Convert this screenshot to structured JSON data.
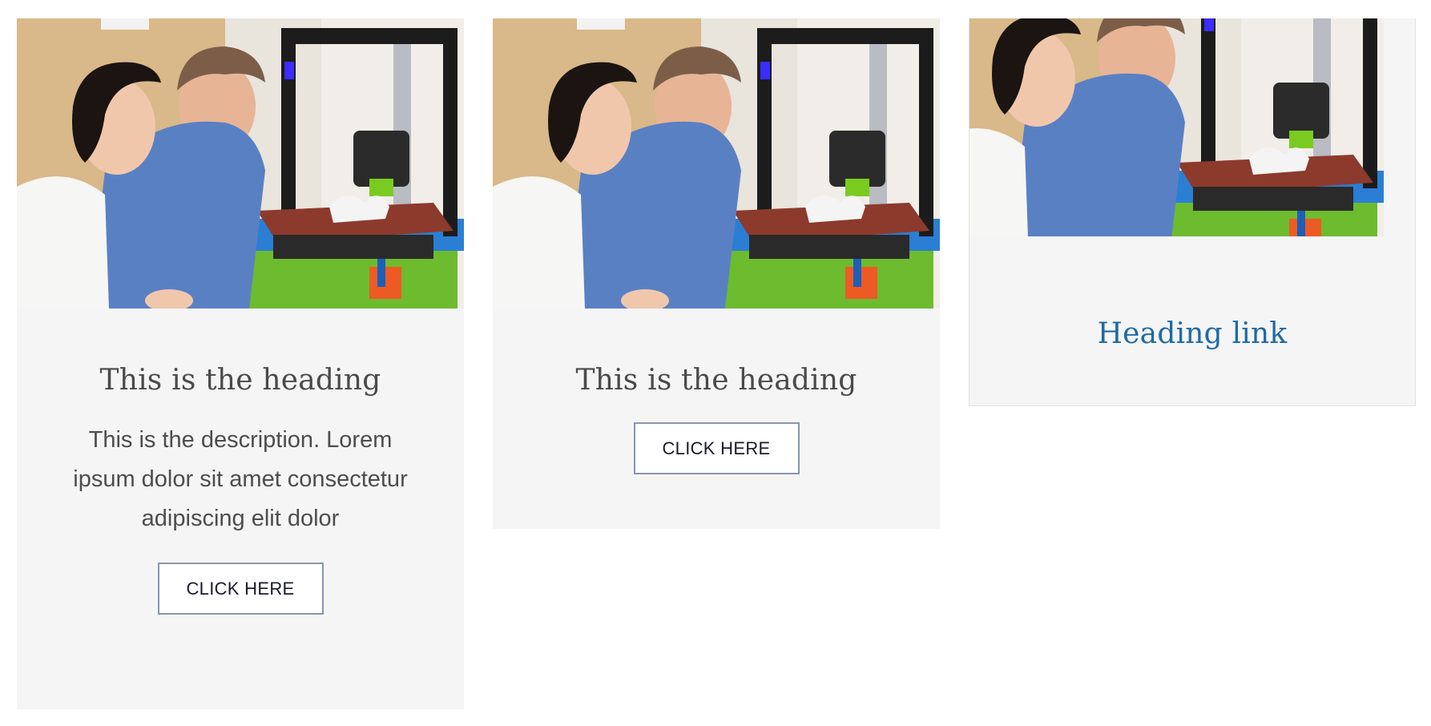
{
  "cards": [
    {
      "heading": "This is the heading",
      "description": "This is the description. Lorem ipsum dolor sit amet consectetur adipiscing elit dolor",
      "button_label": "CLICK HERE",
      "image_icon": "3d-printer-lab-photo"
    },
    {
      "heading": "This is the heading",
      "button_label": "CLICK HERE",
      "image_icon": "3d-printer-lab-photo"
    },
    {
      "heading_link": "Heading link",
      "image_icon": "3d-printer-lab-photo"
    }
  ],
  "colors": {
    "card_background": "#f5f5f5",
    "heading_text": "#4a4a4a",
    "link_text": "#1e6aa6",
    "button_border": "#8796b0"
  }
}
